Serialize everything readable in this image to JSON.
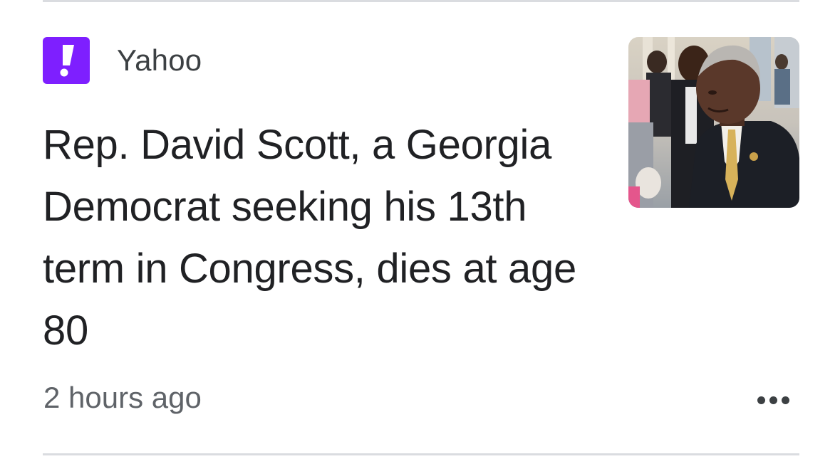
{
  "article": {
    "source": {
      "name": "Yahoo",
      "logo_icon": "yahoo-exclamation-icon",
      "logo_color": "#7e1fff"
    },
    "headline": "Rep. David Scott, a Georgia Democrat seeking his 13th term in Congress, dies at age 80",
    "timestamp": "2 hours ago",
    "more_icon": "more-horizontal-icon",
    "thumbnail_icon": "article-photo"
  }
}
